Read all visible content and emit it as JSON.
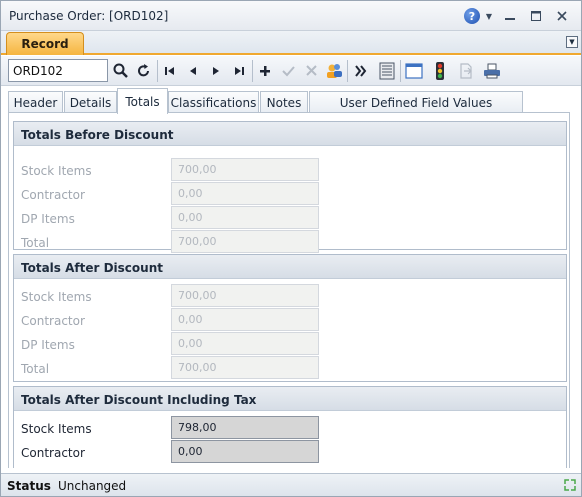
{
  "window": {
    "title": "Purchase Order: [ORD102]"
  },
  "ribbon": {
    "tab_label": "Record"
  },
  "toolbar": {
    "record_value": "ORD102"
  },
  "tabs": [
    {
      "label": "Header"
    },
    {
      "label": "Details"
    },
    {
      "label": "Totals"
    },
    {
      "label": "Classifications"
    },
    {
      "label": "Notes"
    },
    {
      "label": "User Defined Field Values"
    }
  ],
  "sections": [
    {
      "title": "Totals Before Discount",
      "rows": [
        {
          "label": "Stock Items",
          "value": "700,00"
        },
        {
          "label": "Contractor",
          "value": "0,00"
        },
        {
          "label": "DP Items",
          "value": "0,00"
        },
        {
          "label": "Total",
          "value": "700,00"
        }
      ]
    },
    {
      "title": "Totals After Discount",
      "rows": [
        {
          "label": "Stock Items",
          "value": "700,00"
        },
        {
          "label": "Contractor",
          "value": "0,00"
        },
        {
          "label": "DP Items",
          "value": "0,00"
        },
        {
          "label": "Total",
          "value": "700,00"
        }
      ]
    },
    {
      "title": "Totals After Discount Including Tax",
      "rows": [
        {
          "label": "Stock Items",
          "value": "798,00"
        },
        {
          "label": "Contractor",
          "value": "0,00"
        }
      ]
    }
  ],
  "status": {
    "label": "Status",
    "value": "Unchanged"
  },
  "colors": {
    "accent": "#f0a830",
    "record_tab": "#f5b540",
    "section_header": "#d6dde6",
    "enabled_field": "#d6d6d6",
    "disabled_field": "#f1f2f0"
  },
  "icons": [
    "help-icon",
    "dropdown-icon",
    "minimize-icon",
    "restore-icon",
    "close-icon",
    "search-icon",
    "refresh-icon",
    "first-record-icon",
    "previous-record-icon",
    "next-record-icon",
    "last-record-icon",
    "add-icon",
    "save-check-icon",
    "delete-icon",
    "users-icon",
    "more-icon",
    "list-view-icon",
    "window-icon",
    "traffic-light-icon",
    "export-icon",
    "print-icon",
    "resize-icon"
  ]
}
